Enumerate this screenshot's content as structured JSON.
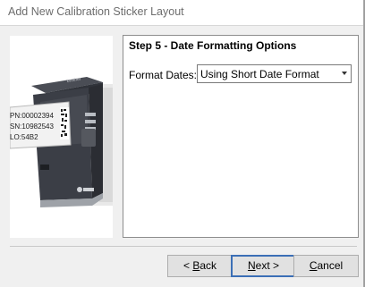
{
  "window": {
    "title": "Add New Calibration Sticker Layout"
  },
  "printer_image": {
    "label_line1": "PN:00002394",
    "label_line2": "SN:10982543",
    "label_line3": "LO:54B2",
    "brand": "brother"
  },
  "step": {
    "title": "Step 5 - Date Formatting Options"
  },
  "format_dates": {
    "label": "Format Dates:",
    "selected": "Using Short Date Format"
  },
  "buttons": {
    "back": {
      "prefix": "< ",
      "accel": "B",
      "rest": "ack"
    },
    "next": {
      "accel": "N",
      "rest": "ext >"
    },
    "cancel": {
      "accel": "C",
      "rest": "ancel"
    }
  }
}
